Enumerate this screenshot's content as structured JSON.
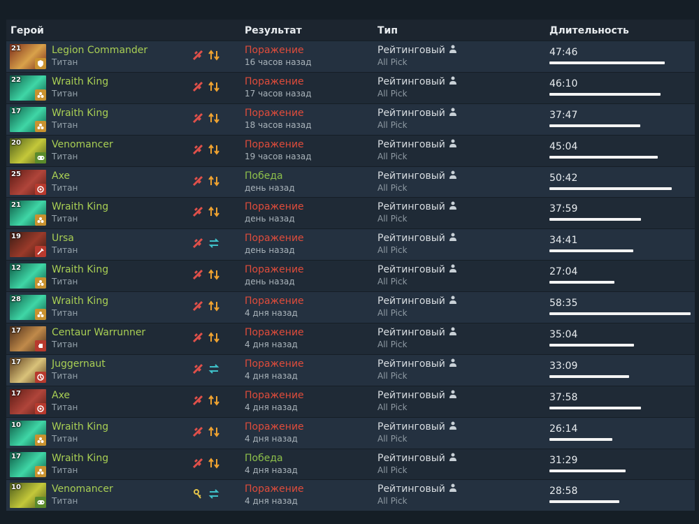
{
  "headers": {
    "hero": "Герой",
    "result": "Результат",
    "type": "Тип",
    "duration": "Длительность"
  },
  "max_duration_minutes": 58.58,
  "colors": {
    "win": "#8ec14b",
    "loss": "#e04c3b",
    "hero_name": "#a9cf54"
  },
  "matches": [
    {
      "level": "21",
      "hero": "Legion Commander",
      "rank": "Титан",
      "result": "Поражение",
      "outcome": "loss",
      "time": "16 часов назад",
      "type": "Рейтинговый",
      "mode": "All Pick",
      "duration": "47:46",
      "duration_min": 47.77,
      "role_icon": "shield-icon",
      "lane_icon": "swap-arrows-icon",
      "portrait": [
        "#7a2b1a",
        "#d9a24a"
      ]
    },
    {
      "level": "22",
      "hero": "Wraith King",
      "rank": "Титан",
      "result": "Поражение",
      "outcome": "loss",
      "time": "17 часов назад",
      "type": "Рейтинговый",
      "mode": "All Pick",
      "duration": "46:10",
      "duration_min": 46.17,
      "role_icon": "support-icon",
      "lane_icon": "swap-arrows-icon",
      "portrait": [
        "#0d5a45",
        "#3fd6a6"
      ]
    },
    {
      "level": "17",
      "hero": "Wraith King",
      "rank": "Титан",
      "result": "Поражение",
      "outcome": "loss",
      "time": "18 часов назад",
      "type": "Рейтинговый",
      "mode": "All Pick",
      "duration": "37:47",
      "duration_min": 37.78,
      "role_icon": "support-icon",
      "lane_icon": "swap-arrows-icon",
      "portrait": [
        "#0d5a45",
        "#3fd6a6"
      ]
    },
    {
      "level": "20",
      "hero": "Venomancer",
      "rank": "Титан",
      "result": "Поражение",
      "outcome": "loss",
      "time": "19 часов назад",
      "type": "Рейтинговый",
      "mode": "All Pick",
      "duration": "45:04",
      "duration_min": 45.07,
      "role_icon": "gamepad-icon",
      "lane_icon": "swap-arrows-icon",
      "portrait": [
        "#4a5a1a",
        "#c4c83a"
      ]
    },
    {
      "level": "25",
      "hero": "Axe",
      "rank": "Титан",
      "result": "Победа",
      "outcome": "win",
      "time": "день назад",
      "type": "Рейтинговый",
      "mode": "All Pick",
      "duration": "50:42",
      "duration_min": 50.7,
      "role_icon": "target-icon",
      "lane_icon": "swap-arrows-icon",
      "portrait": [
        "#5a1a14",
        "#b0453a"
      ]
    },
    {
      "level": "21",
      "hero": "Wraith King",
      "rank": "Титан",
      "result": "Поражение",
      "outcome": "loss",
      "time": "день назад",
      "type": "Рейтинговый",
      "mode": "All Pick",
      "duration": "37:59",
      "duration_min": 37.98,
      "role_icon": "support-icon",
      "lane_icon": "swap-arrows-icon",
      "portrait": [
        "#0d5a45",
        "#3fd6a6"
      ]
    },
    {
      "level": "19",
      "hero": "Ursa",
      "rank": "Титан",
      "result": "Поражение",
      "outcome": "loss",
      "time": "день назад",
      "type": "Рейтинговый",
      "mode": "All Pick",
      "duration": "34:41",
      "duration_min": 34.68,
      "role_icon": "sword-icon",
      "lane_icon": "cycle-arrows-icon",
      "portrait": [
        "#3a1c14",
        "#9a3a2a"
      ]
    },
    {
      "level": "12",
      "hero": "Wraith King",
      "rank": "Титан",
      "result": "Поражение",
      "outcome": "loss",
      "time": "день назад",
      "type": "Рейтинговый",
      "mode": "All Pick",
      "duration": "27:04",
      "duration_min": 27.07,
      "role_icon": "support-icon",
      "lane_icon": "swap-arrows-icon",
      "portrait": [
        "#0d5a45",
        "#3fd6a6"
      ]
    },
    {
      "level": "28",
      "hero": "Wraith King",
      "rank": "Титан",
      "result": "Поражение",
      "outcome": "loss",
      "time": "4 дня назад",
      "type": "Рейтинговый",
      "mode": "All Pick",
      "duration": "58:35",
      "duration_min": 58.58,
      "role_icon": "support-icon",
      "lane_icon": "swap-arrows-icon",
      "portrait": [
        "#0d5a45",
        "#3fd6a6"
      ]
    },
    {
      "level": "17",
      "hero": "Centaur Warrunner",
      "rank": "Титан",
      "result": "Поражение",
      "outcome": "loss",
      "time": "4 дня назад",
      "type": "Рейтинговый",
      "mode": "All Pick",
      "duration": "35:04",
      "duration_min": 35.07,
      "role_icon": "fist-icon",
      "lane_icon": "swap-arrows-icon",
      "portrait": [
        "#4a2c18",
        "#c08a4a"
      ]
    },
    {
      "level": "17",
      "hero": "Juggernaut",
      "rank": "Титан",
      "result": "Поражение",
      "outcome": "loss",
      "time": "4 дня назад",
      "type": "Рейтинговый",
      "mode": "All Pick",
      "duration": "33:09",
      "duration_min": 33.15,
      "role_icon": "carry-icon",
      "lane_icon": "cycle-arrows-icon",
      "portrait": [
        "#5a3a1c",
        "#d9c27a"
      ]
    },
    {
      "level": "17",
      "hero": "Axe",
      "rank": "Титан",
      "result": "Поражение",
      "outcome": "loss",
      "time": "4 дня назад",
      "type": "Рейтинговый",
      "mode": "All Pick",
      "duration": "37:58",
      "duration_min": 37.97,
      "role_icon": "target-icon",
      "lane_icon": "swap-arrows-icon",
      "portrait": [
        "#5a1a14",
        "#b0453a"
      ]
    },
    {
      "level": "10",
      "hero": "Wraith King",
      "rank": "Титан",
      "result": "Поражение",
      "outcome": "loss",
      "time": "4 дня назад",
      "type": "Рейтинговый",
      "mode": "All Pick",
      "duration": "26:14",
      "duration_min": 26.23,
      "role_icon": "support-icon",
      "lane_icon": "swap-arrows-icon",
      "portrait": [
        "#0d5a45",
        "#3fd6a6"
      ]
    },
    {
      "level": "17",
      "hero": "Wraith King",
      "rank": "Титан",
      "result": "Победа",
      "outcome": "win",
      "time": "4 дня назад",
      "type": "Рейтинговый",
      "mode": "All Pick",
      "duration": "31:29",
      "duration_min": 31.48,
      "role_icon": "support-icon",
      "lane_icon": "swap-arrows-icon",
      "portrait": [
        "#0d5a45",
        "#3fd6a6"
      ]
    },
    {
      "level": "10",
      "hero": "Venomancer",
      "rank": "Титан",
      "result": "Поражение",
      "outcome": "loss",
      "time": "4 дня назад",
      "type": "Рейтинговый",
      "mode": "All Pick",
      "duration": "28:58",
      "duration_min": 28.97,
      "role_icon": "gamepad-icon",
      "lane_icon": "cycle-arrows-icon",
      "portrait": [
        "#4a5a1a",
        "#c4c83a"
      ],
      "fav_icon": "key-icon"
    }
  ]
}
